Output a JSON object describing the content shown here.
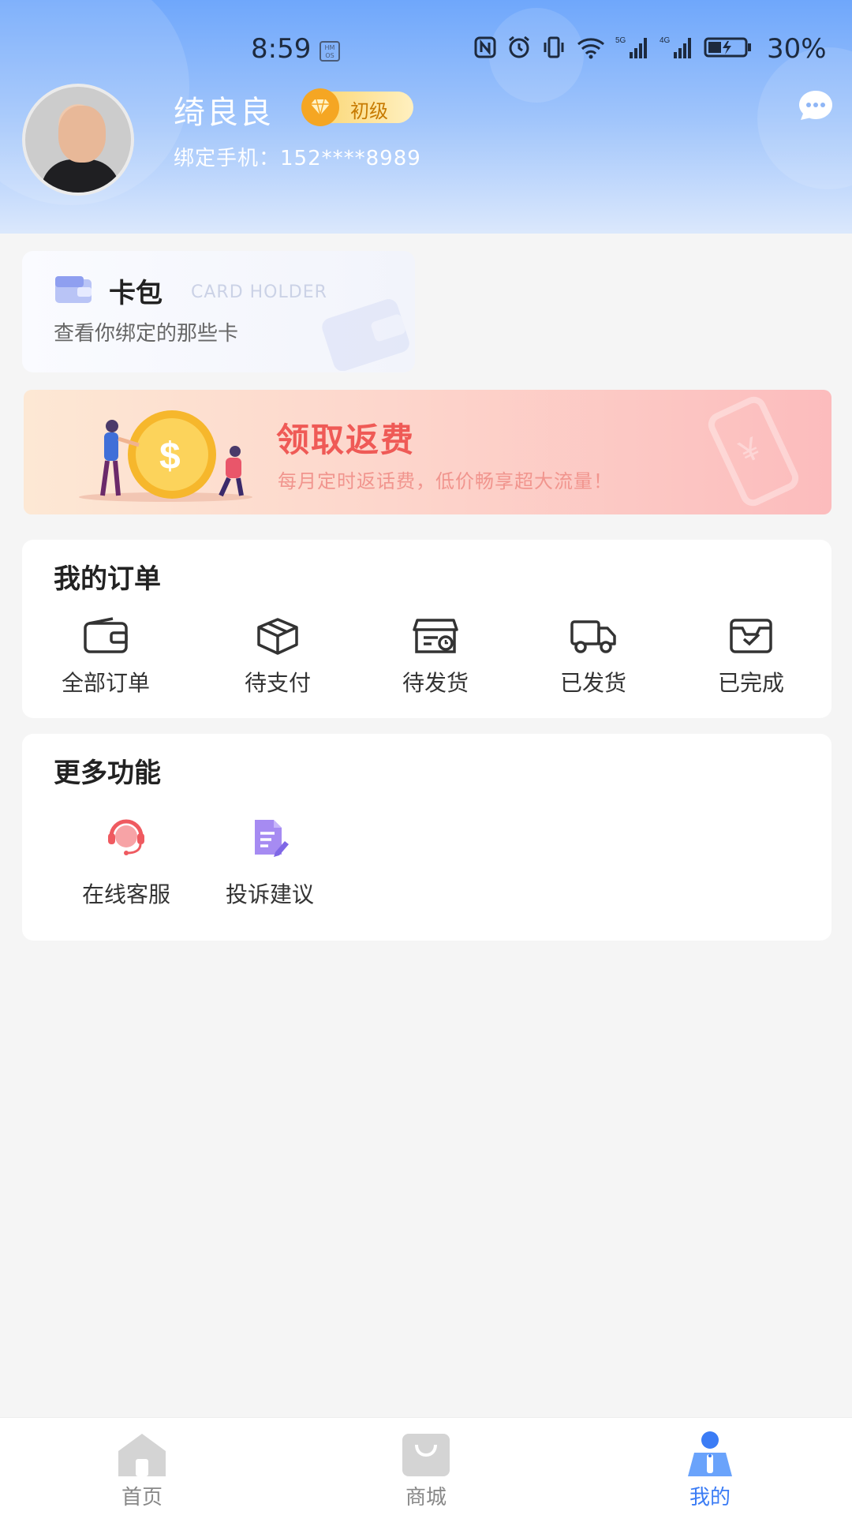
{
  "status_bar": {
    "time": "8:59",
    "os_badge": "HM OS",
    "battery_pct": "30%",
    "icons": [
      "nfc-icon",
      "alarm-icon",
      "vibrate-icon",
      "wifi-icon",
      "signal-5g-icon",
      "signal-4g-icon",
      "battery-icon"
    ]
  },
  "profile": {
    "name": "绮良良",
    "level": "初级",
    "phone_label": "绑定手机：",
    "phone": "152****8989"
  },
  "card_holder": {
    "title": "卡包",
    "title_en": "CARD HOLDER",
    "desc": "查看你绑定的那些卡"
  },
  "banner": {
    "title": "领取返费",
    "subtitle": "每月定时返话费，低价畅享超大流量！"
  },
  "orders": {
    "title": "我的订单",
    "items": [
      {
        "label": "全部订单",
        "icon": "wallet-icon"
      },
      {
        "label": "待支付",
        "icon": "box-icon"
      },
      {
        "label": "待发货",
        "icon": "shop-clock-icon"
      },
      {
        "label": "已发货",
        "icon": "truck-icon"
      },
      {
        "label": "已完成",
        "icon": "inbox-check-icon"
      }
    ]
  },
  "more": {
    "title": "更多功能",
    "items": [
      {
        "label": "在线客服",
        "icon": "headset-icon"
      },
      {
        "label": "投诉建议",
        "icon": "feedback-doc-icon"
      }
    ]
  },
  "bottom_nav": {
    "items": [
      {
        "label": "首页",
        "icon": "home-icon"
      },
      {
        "label": "商城",
        "icon": "shop-bag-icon"
      },
      {
        "label": "我的",
        "icon": "profile-icon"
      }
    ],
    "active": 2
  },
  "colors": {
    "accent": "#3b7cf5",
    "header_top": "#6fa7fb",
    "banner_title": "#ef5a56",
    "level_badge": "#f5a623"
  }
}
